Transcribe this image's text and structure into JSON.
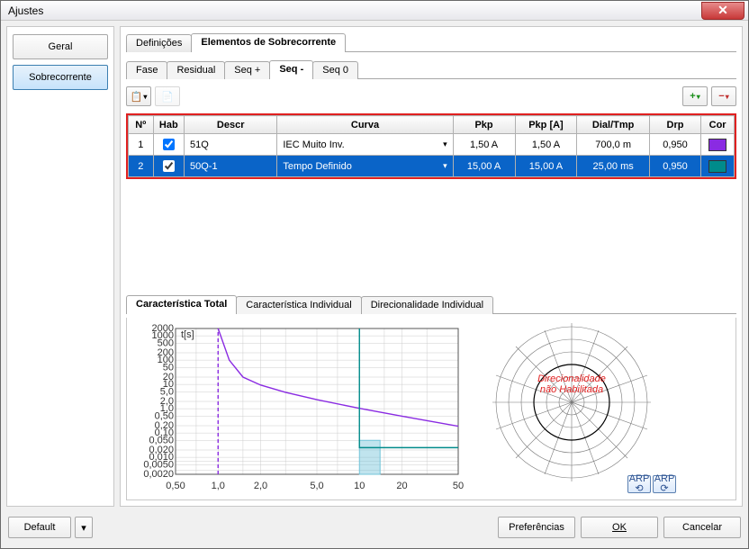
{
  "window_title": "Ajustes",
  "sidebar": {
    "geral": "Geral",
    "sobrecorrente": "Sobrecorrente"
  },
  "tabs": {
    "definicoes": "Definições",
    "elementos": "Elementos de Sobrecorrente"
  },
  "subtabs": {
    "fase": "Fase",
    "residual": "Residual",
    "seqp": "Seq +",
    "seqm": "Seq -",
    "seq0": "Seq 0"
  },
  "toolbar": {
    "copy_icon": "📋",
    "paste_icon": "📄",
    "plus": "+",
    "minus": "−"
  },
  "columns": {
    "no": "Nº",
    "hab": "Hab",
    "descr": "Descr",
    "curva": "Curva",
    "pkp": "Pkp",
    "pkpa": "Pkp [A]",
    "dial": "Dial/Tmp",
    "drp": "Drp",
    "cor": "Cor"
  },
  "rows": [
    {
      "no": "1",
      "hab": true,
      "descr": "51Q",
      "curva": "IEC Muito Inv.",
      "pkp": "1,50 A",
      "pkpa": "1,50 A",
      "dial": "700,0 m",
      "drp": "0,950",
      "cor": "#8a2be2"
    },
    {
      "no": "2",
      "hab": true,
      "descr": "50Q-1",
      "curva": "Tempo Definido",
      "pkp": "15,00 A",
      "pkpa": "15,00 A",
      "dial": "25,00 ms",
      "drp": "0,950",
      "cor": "#008b8b"
    }
  ],
  "lower_tabs": {
    "total": "Característica Total",
    "individual": "Característica Individual",
    "direc": "Direcionalidade Individual"
  },
  "direc_msg": {
    "l1": "Direcionalidade",
    "l2": "não Habilitada"
  },
  "arp": "ARP",
  "footer": {
    "default": "Default",
    "pref": "Preferências",
    "ok": "OK",
    "cancel": "Cancelar"
  },
  "chart_data": {
    "type": "line",
    "title": "t[s]",
    "xscale": "log",
    "yscale": "log",
    "xticks": [
      "0,50",
      "1,0",
      "2,0",
      "5,0",
      "10",
      "20",
      "50"
    ],
    "yticks": [
      "0,0020",
      "0,0050",
      "0,010",
      "0,020",
      "0,050",
      "0,10",
      "0,20",
      "0,50",
      "1,0",
      "2,0",
      "5,0",
      "10",
      "20",
      "50",
      "100",
      "200",
      "500",
      "1000",
      "2000"
    ],
    "xlim": [
      0.5,
      50
    ],
    "ylim": [
      0.002,
      2000
    ],
    "series": [
      {
        "name": "51Q IEC Muito Inv.",
        "color": "#8a2be2",
        "x": [
          1.0,
          1.2,
          1.5,
          2.0,
          3.0,
          5.0,
          10,
          20,
          50
        ],
        "y": [
          2000,
          100,
          20,
          9.4,
          4.7,
          2.35,
          1.04,
          0.49,
          0.19
        ]
      },
      {
        "name": "50Q-1 Tempo Definido",
        "color": "#008b8b",
        "x": [
          10,
          10,
          50
        ],
        "y": [
          2000,
          0.025,
          0.025
        ]
      },
      {
        "name": "pickup-line",
        "color": "#8a2be2",
        "dash": true,
        "x": [
          1.0,
          1.0
        ],
        "y": [
          0.002,
          2000
        ]
      },
      {
        "name": "definite-band",
        "color": "#73c4d9",
        "fill": true,
        "x": [
          10,
          10,
          14,
          14
        ],
        "y": [
          0.002,
          0.05,
          0.05,
          0.002
        ]
      }
    ]
  }
}
